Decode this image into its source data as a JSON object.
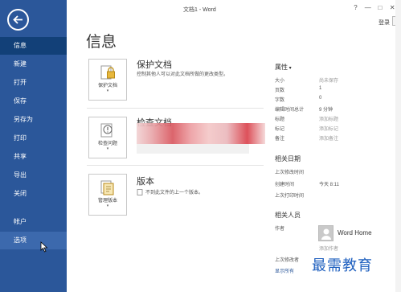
{
  "window": {
    "title": "文档1 - Word",
    "help": "?",
    "minimize": "—",
    "restore": "□",
    "close": "✕",
    "signin": "登录"
  },
  "sidebar": {
    "items": [
      {
        "label": "信息"
      },
      {
        "label": "新建"
      },
      {
        "label": "打开"
      },
      {
        "label": "保存"
      },
      {
        "label": "另存为"
      },
      {
        "label": "打印"
      },
      {
        "label": "共享"
      },
      {
        "label": "导出"
      },
      {
        "label": "关闭"
      },
      {
        "label": "帐户"
      },
      {
        "label": "选项"
      }
    ]
  },
  "page": {
    "title": "信息"
  },
  "protect": {
    "button": "保护文档",
    "title": "保护文档",
    "desc": "控制其他人可以对此文档所做的更改类型。"
  },
  "inspect": {
    "button": "检查问题",
    "title": "检查文档"
  },
  "versions": {
    "button": "管理版本",
    "title": "版本",
    "desc": "不到此文件的上一个版本。"
  },
  "properties": {
    "heading": "属性",
    "rows": [
      {
        "k": "大小",
        "v": "尚未保存",
        "muted": true
      },
      {
        "k": "页数",
        "v": "1",
        "muted": false
      },
      {
        "k": "字数",
        "v": "0",
        "muted": false
      },
      {
        "k": "编辑时间总计",
        "v": "9 分钟",
        "muted": false
      },
      {
        "k": "标题",
        "v": "添加标题",
        "muted": true
      },
      {
        "k": "标记",
        "v": "添加标记",
        "muted": true
      },
      {
        "k": "备注",
        "v": "添加备注",
        "muted": true
      }
    ]
  },
  "dates": {
    "heading": "相关日期",
    "rows": [
      {
        "k": "上次修改时间",
        "v": ""
      },
      {
        "k": "创建时间",
        "v": "今天 8:11"
      },
      {
        "k": "上次打印时间",
        "v": ""
      }
    ]
  },
  "people": {
    "heading": "相关人员",
    "author_label": "作者",
    "author_name": "Word Home",
    "add_author": "添加作者",
    "last_modified_by": "上次修改者",
    "show_all": "显示所有"
  },
  "watermark": "最需教育"
}
